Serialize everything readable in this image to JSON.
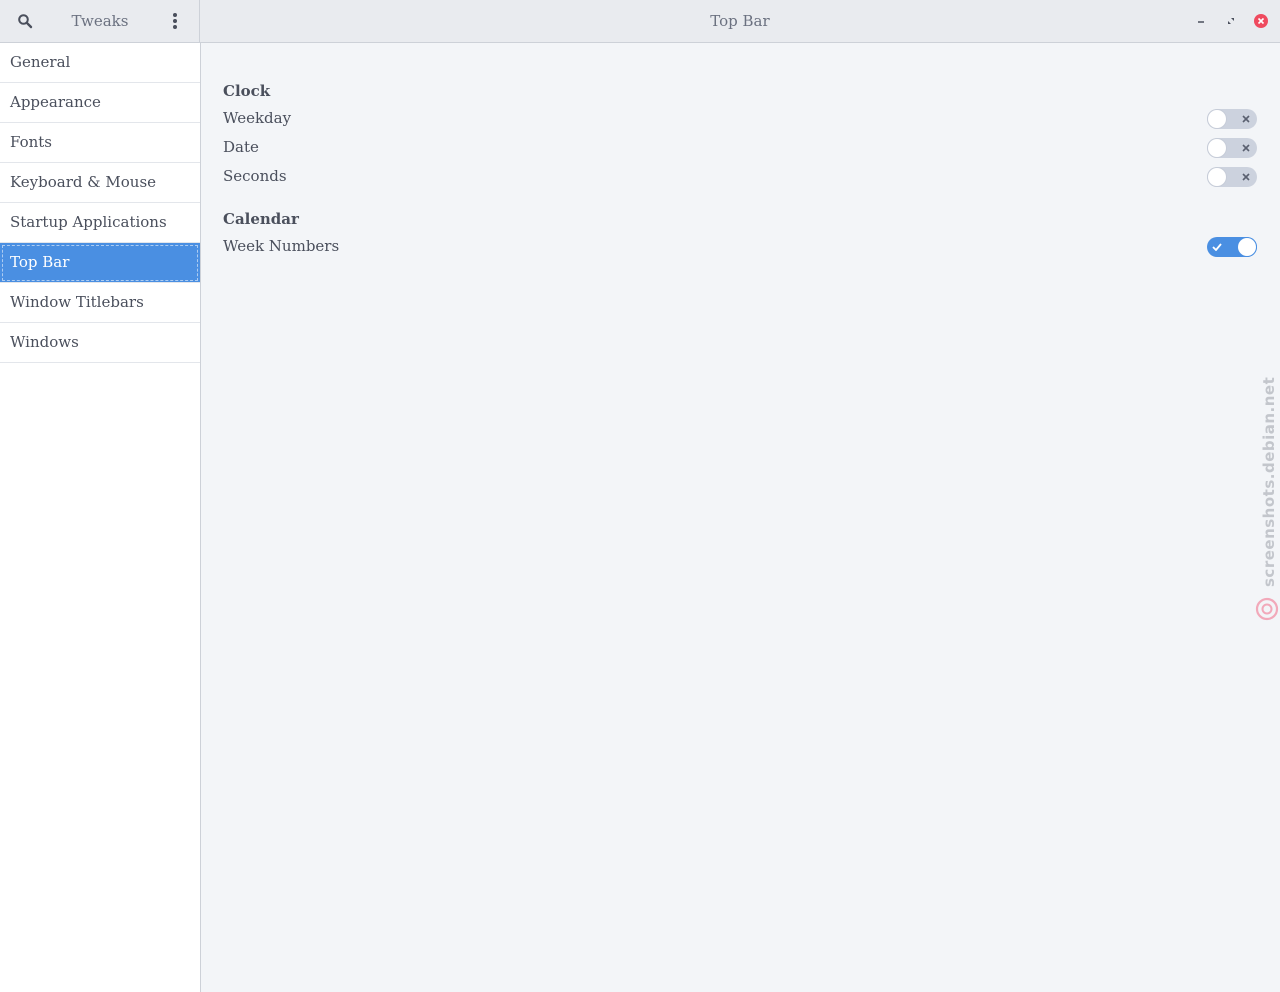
{
  "header": {
    "app_title": "Tweaks",
    "page_title": "Top Bar",
    "icons": {
      "search": "search-icon",
      "menu": "vertical-dots-icon",
      "minimize": "minimize-icon",
      "maximize": "maximize-icon",
      "close": "close-icon"
    }
  },
  "sidebar": {
    "items": [
      {
        "label": "General",
        "selected": false
      },
      {
        "label": "Appearance",
        "selected": false
      },
      {
        "label": "Fonts",
        "selected": false
      },
      {
        "label": "Keyboard & Mouse",
        "selected": false
      },
      {
        "label": "Startup Applications",
        "selected": false
      },
      {
        "label": "Top Bar",
        "selected": true
      },
      {
        "label": "Window Titlebars",
        "selected": false
      },
      {
        "label": "Windows",
        "selected": false
      }
    ]
  },
  "main": {
    "clock": {
      "heading": "Clock",
      "weekday": {
        "label": "Weekday",
        "enabled": false
      },
      "date": {
        "label": "Date",
        "enabled": false
      },
      "seconds": {
        "label": "Seconds",
        "enabled": false
      }
    },
    "calendar": {
      "heading": "Calendar",
      "week_numbers": {
        "label": "Week Numbers",
        "enabled": true
      }
    }
  },
  "watermark": {
    "text": "screenshots.debian.net"
  },
  "colors": {
    "accent": "#4a8fe2",
    "close_button": "#ef4a5f",
    "switch_off": "#ccd2de",
    "watermark_logo": "#f06a87"
  }
}
